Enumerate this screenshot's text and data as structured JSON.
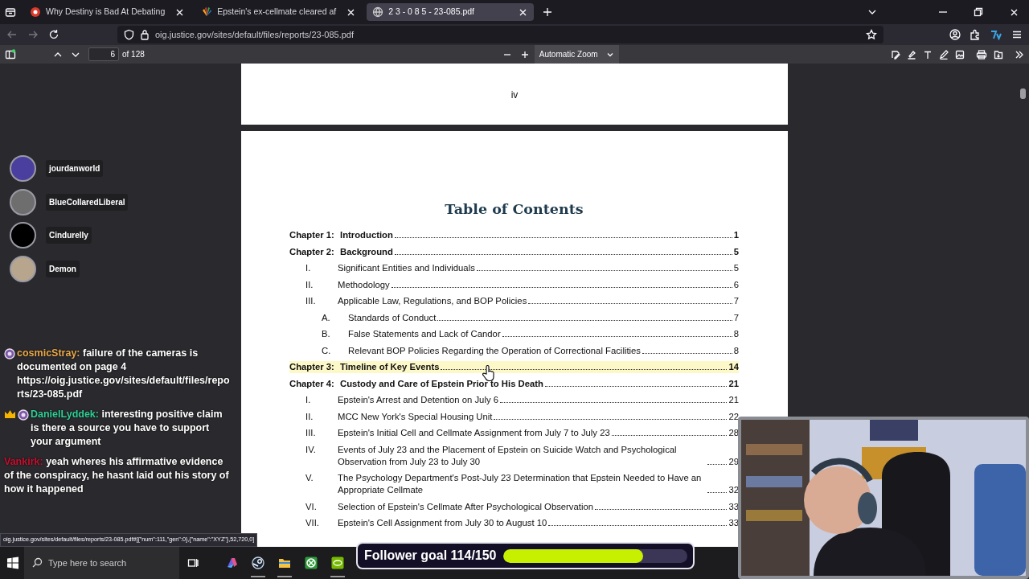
{
  "browser": {
    "tabs": [
      {
        "title": "Why Destiny is Bad At Debating",
        "kind": "video",
        "selected": false
      },
      {
        "title": "Epstein's ex-cellmate cleared af",
        "kind": "news",
        "selected": false
      },
      {
        "title": "2 3 - 0 8 5 - 23-085.pdf",
        "kind": "document",
        "selected": true
      }
    ],
    "url": "oig.justice.gov/sites/default/files/reports/23-085.pdf",
    "status_link": "oig.justice.gov/sites/default/files/reports/23-085.pdf#[{\"num\":111,\"gen\":0},{\"name\":\"XYZ\"},52,720,0]"
  },
  "pdf_toolbar": {
    "page": "6",
    "page_count": "of 128",
    "zoom": "Automatic Zoom"
  },
  "document": {
    "previous_page_number": "iv",
    "toc_title": "Table of Contents",
    "entries": [
      {
        "number": "Chapter 1:",
        "title": "Introduction",
        "page": "1",
        "highlighted": false
      },
      {
        "number": "Chapter 2:",
        "title": "Background",
        "page": "5",
        "highlighted": false,
        "children": [
          {
            "number": "I.",
            "title": "Significant Entities and Individuals",
            "page": "5"
          },
          {
            "number": "II.",
            "title": "Methodology",
            "page": "6"
          },
          {
            "number": "III.",
            "title": "Applicable Law, Regulations, and BOP Policies",
            "page": "7",
            "children": [
              {
                "number": "A.",
                "title": "Standards of Conduct",
                "page": "7"
              },
              {
                "number": "B.",
                "title": "False Statements and Lack of Candor",
                "page": "8"
              },
              {
                "number": "C.",
                "title": "Relevant BOP Policies Regarding the Operation of Correctional Facilities",
                "page": "8"
              }
            ]
          }
        ]
      },
      {
        "number": "Chapter 3:",
        "title": "Timeline of Key Events",
        "page": "14",
        "highlighted": true
      },
      {
        "number": "Chapter 4:",
        "title": "Custody and Care of Epstein Prior to His Death",
        "page": "21",
        "highlighted": false,
        "children": [
          {
            "number": "I.",
            "title": "Epstein's Arrest and Detention on July 6",
            "page": "21"
          },
          {
            "number": "II.",
            "title": "MCC New York's Special Housing Unit",
            "page": "22"
          },
          {
            "number": "III.",
            "title": "Epstein's Initial Cell and Cellmate Assignment from July 7 to July 23",
            "page": "28"
          },
          {
            "number": "IV.",
            "title": "Events of July 23 and the Placement of Epstein on Suicide Watch and Psychological Observation from July 23 to July 30",
            "page": "29"
          },
          {
            "number": "V.",
            "title": "The Psychology Department's Post-July 23 Determination that Epstein Needed to Have an Appropriate Cellmate",
            "page": "32"
          },
          {
            "number": "VI.",
            "title": "Selection of Epstein's Cellmate After Psychological Observation",
            "page": "33"
          },
          {
            "number": "VII.",
            "title": "Epstein's Cell Assignment from July 30 to August 10",
            "page": "33"
          }
        ]
      }
    ]
  },
  "voice_users": [
    {
      "name": "jourdanworld",
      "color": "#4a3f9e"
    },
    {
      "name": "BlueCollaredLiberal",
      "color": "#6e6e6e"
    },
    {
      "name": "Cindurelly",
      "color": "#000000"
    },
    {
      "name": "Demon",
      "color": "#b8a58e"
    }
  ],
  "chat": [
    {
      "badges": [
        {
          "kind": "sub"
        }
      ],
      "user": "cosmicStray:",
      "color": "#eba94a",
      "message": "failure of the cameras is documented on page 4 https://oig.justice.gov/sites/default/files/reports/23-085.pdf"
    },
    {
      "badges": [
        {
          "kind": "crown"
        },
        {
          "kind": "sub"
        }
      ],
      "user": "DanielLyddek:",
      "color": "#2fcf95",
      "message": "interesting positive claim is there a source you have to support your argument"
    },
    {
      "user": "Vankirk:",
      "color": "#c8102e",
      "message": "yeah wheres his affirmative evidence of the conspiracy, he hasnt laid out his story of how it happened"
    }
  ],
  "follower_goal": {
    "label": "Follower goal 114/150",
    "level": 0.76
  },
  "taskbar": {
    "search_placeholder": "Type here to search",
    "apps": [
      {
        "kind": "copilot",
        "running": false
      },
      {
        "kind": "steam",
        "running": true
      },
      {
        "kind": "explorer",
        "running": true
      },
      {
        "kind": "xbox",
        "running": false
      },
      {
        "kind": "nvidia",
        "running": true
      }
    ]
  }
}
